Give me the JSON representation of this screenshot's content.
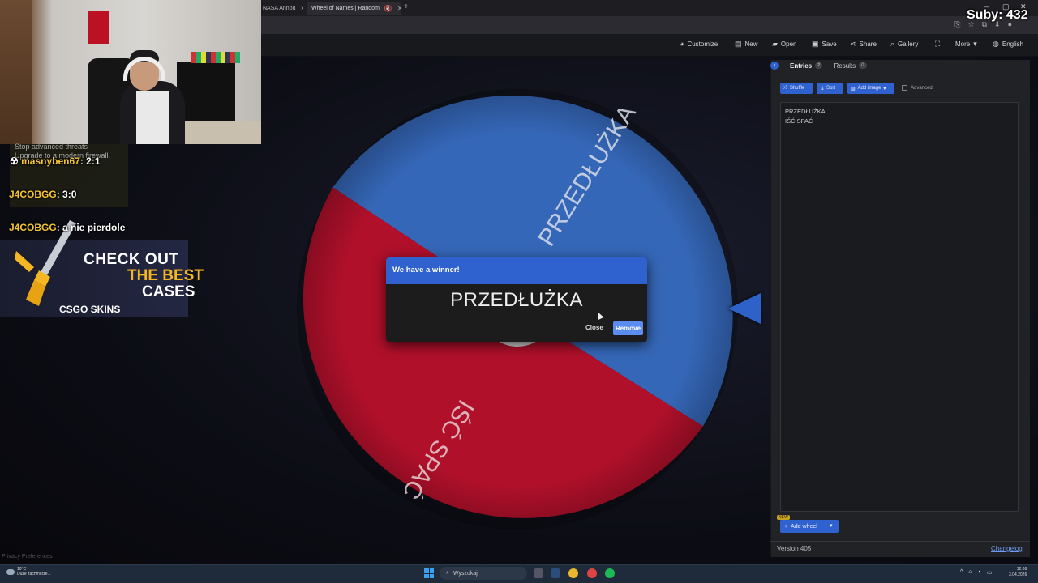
{
  "browser": {
    "tabs": [
      {
        "title": "NASA Annou"
      },
      {
        "title": "Wheel of Names | Random"
      }
    ],
    "new_tab": "+",
    "window_controls": [
      "–",
      "▢",
      "✕"
    ]
  },
  "navbar": {
    "customize": "Customize",
    "new": "New",
    "open": "Open",
    "save": "Save",
    "share": "Share",
    "gallery": "Gallery",
    "more": "More",
    "language": "English"
  },
  "overlay": {
    "subs_label": "Suby: 432",
    "faded_ad": [
      "Stop advanced threats",
      "Upgrade to a modern firewall."
    ],
    "chat": [
      {
        "user": "masnyben67",
        "message": "2:1"
      },
      {
        "user": "J4COBGG",
        "message": "3:0"
      },
      {
        "user": "J4COBGG",
        "message": "a nie pierdole"
      }
    ],
    "csgo_ad": {
      "line1": "CHECK OUT",
      "line2": "THE BEST",
      "line3": "CASES",
      "brand": "CSGO SKINS"
    }
  },
  "wheel": {
    "segments": [
      {
        "label": "PRZEDŁUŻKA",
        "color": "#3567b8"
      },
      {
        "label": "IŚĆ SPAĆ",
        "color": "#b0102a"
      }
    ]
  },
  "dialog": {
    "title": "We have a winner!",
    "winner": "PRZEDŁUŻKA",
    "close_label": "Close",
    "remove_label": "Remove"
  },
  "panel": {
    "tabs": [
      {
        "label": "Entries",
        "count": "2"
      },
      {
        "label": "Results",
        "count": "0"
      }
    ],
    "toolbar": {
      "shuffle": "Shuffle",
      "sort": "Sort",
      "add_image": "Add image",
      "advanced": "Advanced"
    },
    "entries": [
      "PRZEDŁUŻKA",
      "IŚĆ SPAĆ"
    ],
    "add_wheel": "Add wheel",
    "new_badge": "NEW",
    "version": "Version 405",
    "changelog": "Changelog"
  },
  "privacy": "Privacy Preferences",
  "taskbar": {
    "weather_temp": "10°C",
    "weather_desc": "Duże zachmurze...",
    "search_placeholder": "Wyszukaj",
    "time": "12:08",
    "date": "3.04.2026"
  },
  "colors": {
    "accent": "#2f62cf",
    "wheel_blue": "#3567b8",
    "wheel_red": "#b0102a",
    "chat_user": "#f4c431"
  }
}
